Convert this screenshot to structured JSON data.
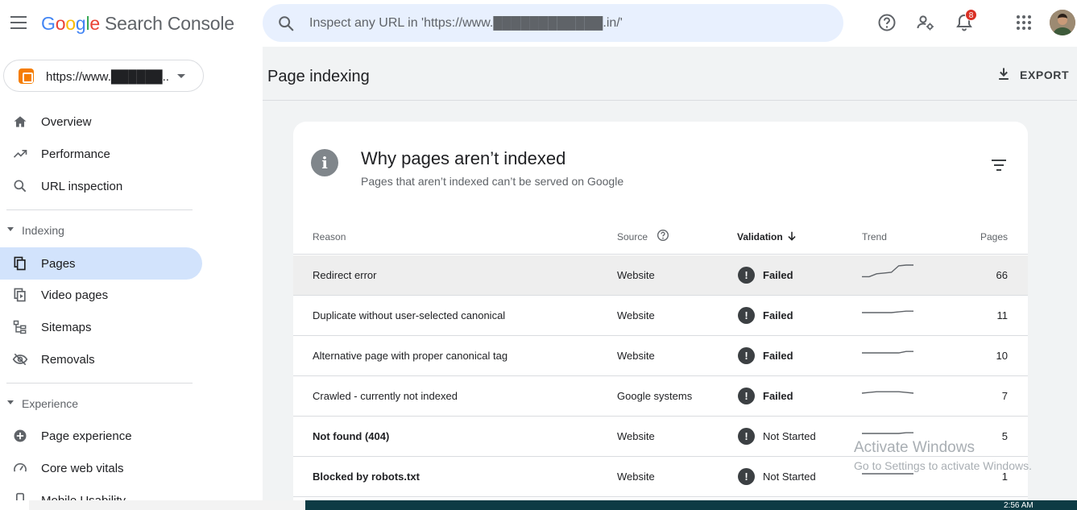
{
  "app": {
    "logo_letters": [
      "G",
      "o",
      "o",
      "g",
      "l",
      "e"
    ],
    "product": "Search Console"
  },
  "search": {
    "placeholder": "Inspect any URL in 'https://www.████████████.in/'"
  },
  "topbar": {
    "notification_count": "8"
  },
  "property": {
    "label": "https://www.██████.."
  },
  "sidebar": {
    "items_top": [
      {
        "label": "Overview",
        "icon": "home-icon"
      },
      {
        "label": "Performance",
        "icon": "trending-up-icon"
      },
      {
        "label": "URL inspection",
        "icon": "search-icon"
      }
    ],
    "indexing_label": "Indexing",
    "indexing_items": [
      {
        "label": "Pages",
        "icon": "pages-icon",
        "active": true
      },
      {
        "label": "Video pages",
        "icon": "video-pages-icon"
      },
      {
        "label": "Sitemaps",
        "icon": "sitemap-icon"
      },
      {
        "label": "Removals",
        "icon": "removals-icon"
      }
    ],
    "experience_label": "Experience",
    "experience_items": [
      {
        "label": "Page experience",
        "icon": "page-experience-icon"
      },
      {
        "label": "Core web vitals",
        "icon": "gauge-icon"
      },
      {
        "label": "Mobile Usability",
        "icon": "mobile-icon"
      }
    ]
  },
  "page": {
    "title": "Page indexing",
    "export_label": "EXPORT"
  },
  "card": {
    "title": "Why pages aren’t indexed",
    "subtitle": "Pages that aren’t indexed can’t be served on Google",
    "columns": {
      "reason": "Reason",
      "source": "Source",
      "validation": "Validation",
      "trend": "Trend",
      "pages": "Pages"
    },
    "rows": [
      {
        "reason": "Redirect error",
        "source": "Website",
        "validation": "Failed",
        "pages": "66",
        "trend": [
          0.2,
          0.2,
          0.4,
          0.45,
          0.5,
          0.95,
          1.0,
          1.0
        ],
        "bold": false,
        "highlight": true
      },
      {
        "reason": "Duplicate without user-selected canonical",
        "source": "Website",
        "validation": "Failed",
        "pages": "11",
        "trend": [
          0.5,
          0.5,
          0.5,
          0.5,
          0.5,
          0.55,
          0.6,
          0.6
        ],
        "bold": false,
        "highlight": false
      },
      {
        "reason": "Alternative page with proper canonical tag",
        "source": "Website",
        "validation": "Failed",
        "pages": "10",
        "trend": [
          0.5,
          0.5,
          0.5,
          0.5,
          0.5,
          0.5,
          0.6,
          0.6
        ],
        "bold": false,
        "highlight": false
      },
      {
        "reason": "Crawled - currently not indexed",
        "source": "Google systems",
        "validation": "Failed",
        "pages": "7",
        "trend": [
          0.5,
          0.55,
          0.6,
          0.6,
          0.6,
          0.6,
          0.55,
          0.5
        ],
        "bold": false,
        "highlight": false
      },
      {
        "reason": "Not found (404)",
        "source": "Website",
        "validation": "Not Started",
        "pages": "5",
        "trend": [
          0.5,
          0.5,
          0.5,
          0.5,
          0.5,
          0.5,
          0.55,
          0.55
        ],
        "bold": true,
        "highlight": false
      },
      {
        "reason": "Blocked by robots.txt",
        "source": "Website",
        "validation": "Not Started",
        "pages": "1",
        "trend": [
          0.5,
          0.5,
          0.5,
          0.5,
          0.5,
          0.5,
          0.5,
          0.5
        ],
        "bold": true,
        "highlight": false
      }
    ]
  },
  "overlay": {
    "activate_title": "Activate Windows",
    "activate_sub": "Go to Settings to activate Windows.",
    "clock": "2:56 AM"
  },
  "colors": {
    "accent": "#1a73e8",
    "active_nav": "#d2e3fc",
    "badge": "#d93025"
  }
}
